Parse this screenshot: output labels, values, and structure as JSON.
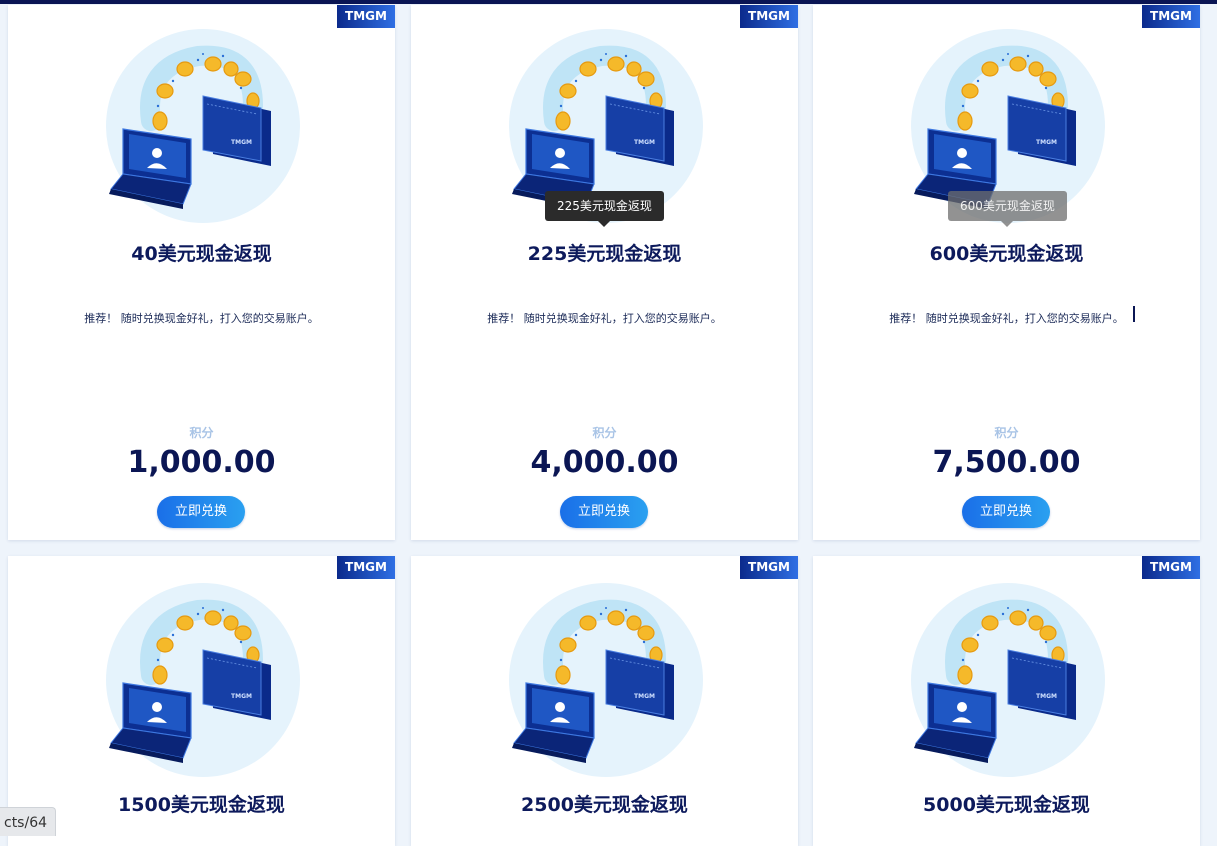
{
  "badge_text": "TMGM",
  "points_label": "积分",
  "redeem_label": "立即兑换",
  "cards": [
    {
      "title": "40美元现金返现",
      "desc": "推荐！ 随时兑换现金好礼，打入您的交易账户。",
      "points": "1,000.00"
    },
    {
      "title": "225美元现金返现",
      "desc": "推荐！ 随时兑换现金好礼，打入您的交易账户。",
      "points": "4,000.00"
    },
    {
      "title": "600美元现金返现",
      "desc": "推荐！ 随时兑换现金好礼，打入您的交易账户。",
      "points": "7,500.00"
    },
    {
      "title": "1500美元现金返现"
    },
    {
      "title": "2500美元现金返现"
    },
    {
      "title": "5000美元现金返现"
    }
  ],
  "tooltips": [
    "225美元现金返现",
    "600美元现金返现"
  ],
  "status_url": "cts/64",
  "colors": {
    "navy": "#0b1654",
    "accent": "#1a6fe8",
    "background": "#eef4fb"
  }
}
